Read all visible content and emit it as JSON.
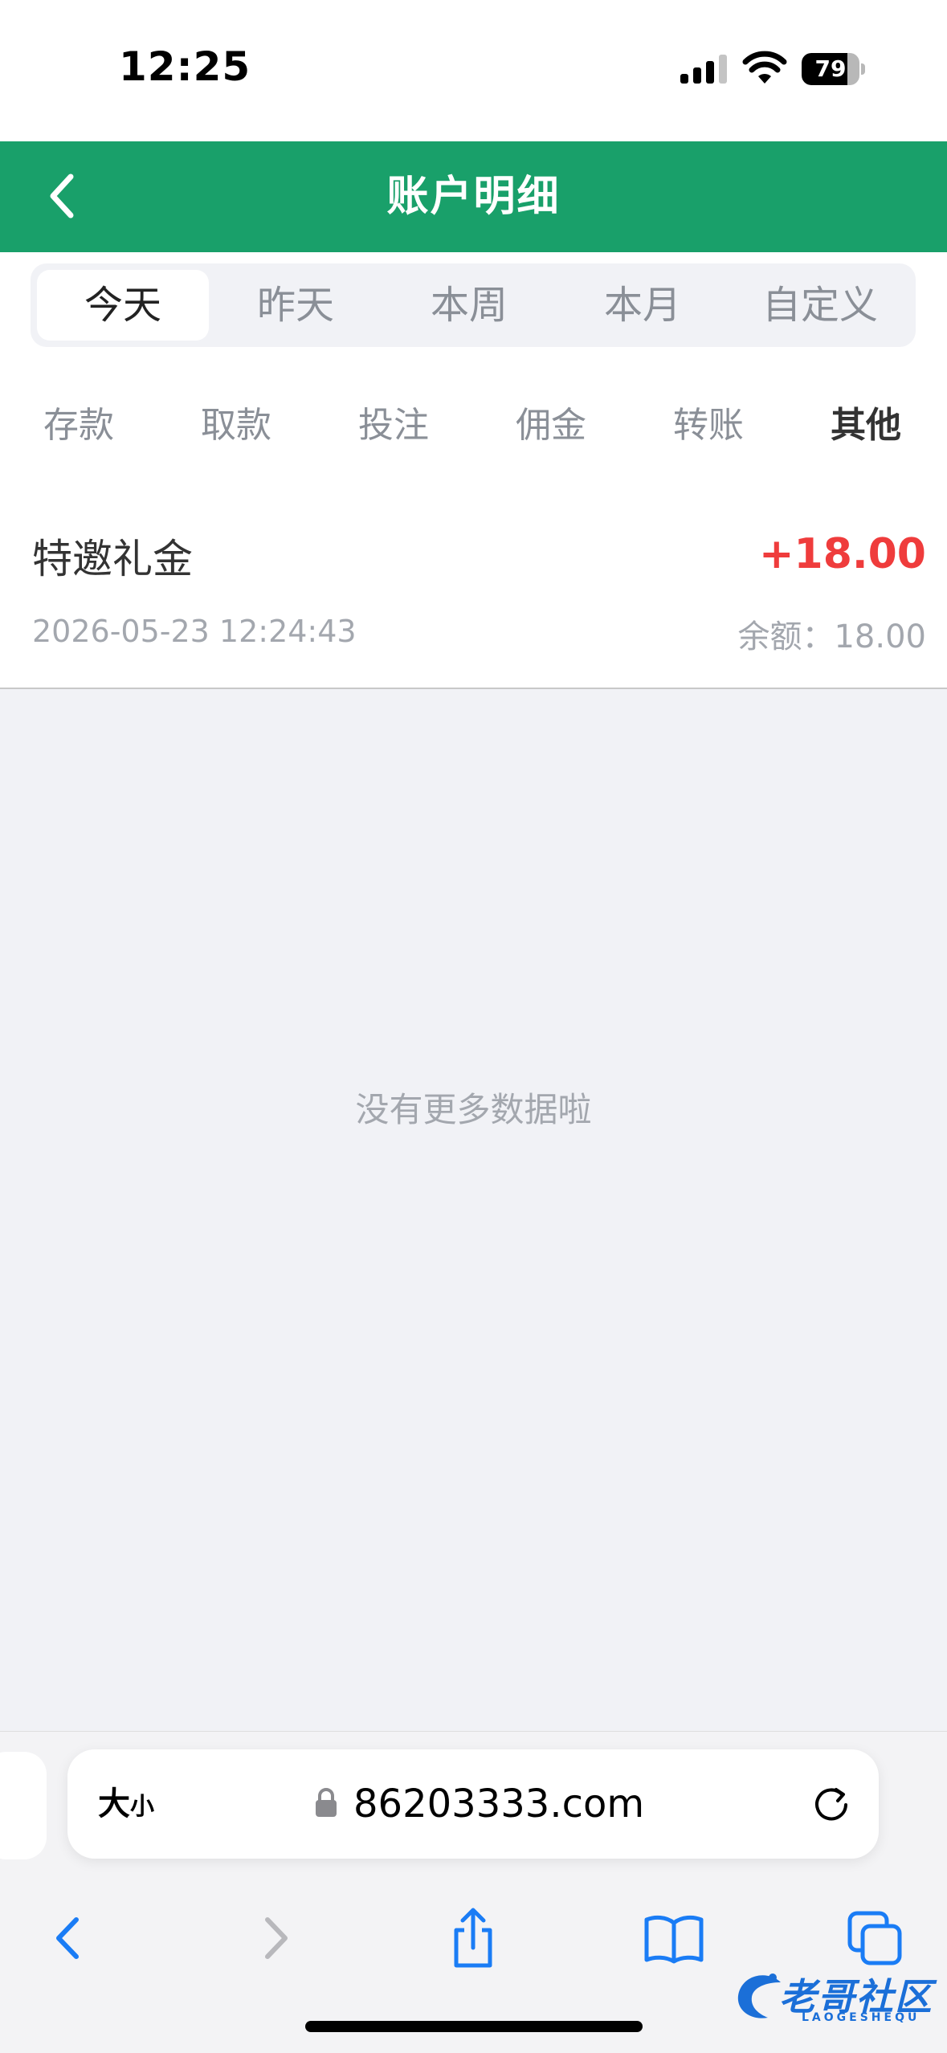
{
  "status_bar": {
    "time": "12:25",
    "battery": "79",
    "battery_level": 0.79
  },
  "header": {
    "title": "账户明细",
    "back_icon": "chevron-left-icon"
  },
  "date_tabs": [
    {
      "label": "今天",
      "active": true
    },
    {
      "label": "昨天",
      "active": false
    },
    {
      "label": "本周",
      "active": false
    },
    {
      "label": "本月",
      "active": false
    },
    {
      "label": "自定义",
      "active": false
    }
  ],
  "category_tabs": [
    {
      "label": "存款",
      "active": false
    },
    {
      "label": "取款",
      "active": false
    },
    {
      "label": "投注",
      "active": false
    },
    {
      "label": "佣金",
      "active": false
    },
    {
      "label": "转账",
      "active": false
    },
    {
      "label": "其他",
      "active": true
    }
  ],
  "records": [
    {
      "title": "特邀礼金",
      "time": "2026-05-23 12:24:43",
      "amount": "+18.00",
      "balance": "余额：18.00"
    }
  ],
  "empty_message": "没有更多数据啦",
  "browser": {
    "text_size_large": "大",
    "text_size_small": "小",
    "url": "86203333.com",
    "toolbar_icons": [
      "back-icon",
      "forward-icon",
      "share-icon",
      "bookmarks-icon",
      "tabs-icon"
    ]
  },
  "watermark": {
    "text": "老哥社区",
    "sub": "LAOGESHEQU"
  },
  "colors": {
    "primary": "#19a06a",
    "amount": "#ef3c3c",
    "muted": "#a3a7ae",
    "link": "#1a7cf5"
  }
}
